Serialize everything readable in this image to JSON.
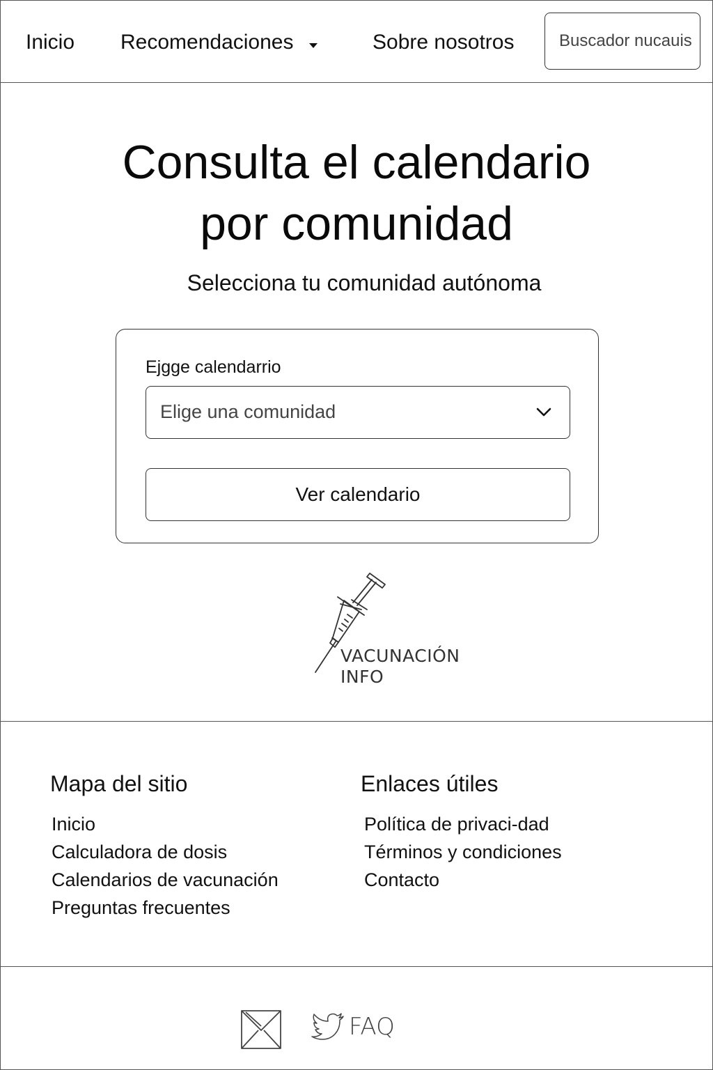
{
  "nav": {
    "home": "Inicio",
    "recommendations": "Recomendaciones",
    "about": "Sobre nosotros",
    "search_placeholder": "Buscador nucauis"
  },
  "hero": {
    "title_line1": "Consulta el calendario",
    "title_line2": "por comunidad",
    "subtitle": "Selecciona tu comunidad autónoma"
  },
  "form": {
    "label": "Ejgge calendarrio",
    "select_placeholder": "Elige una comunidad",
    "button": "Ver calendario"
  },
  "graphic": {
    "icon": "syringe-icon",
    "line1": "VACUNACIÓN",
    "line2": "INFO"
  },
  "footer": {
    "sitemap": {
      "heading": "Mapa del sitio",
      "links": [
        "Inicio",
        "Calculadora de dosis",
        "Calendarios de vacunación",
        "Preguntas frecuentes"
      ]
    },
    "useful": {
      "heading": "Enlaces útiles",
      "links": [
        "Política de privaci-dad",
        "Términos y condiciones",
        "Contacto"
      ]
    },
    "social": {
      "icons": [
        "mail-icon",
        "twitter-icon"
      ],
      "faq": "FAQ"
    }
  }
}
